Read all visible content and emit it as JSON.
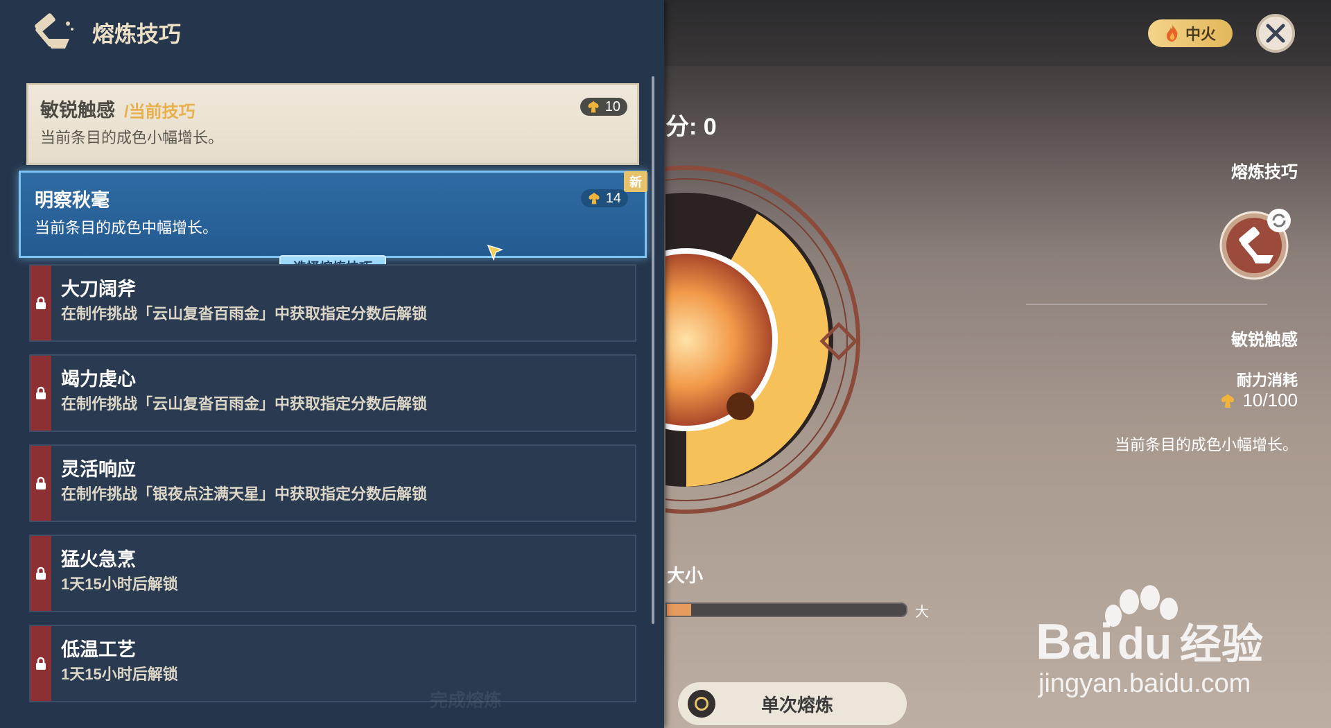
{
  "panel": {
    "title": "熔炼技巧",
    "current": {
      "title": "敏锐触感",
      "tag": "/当前技巧",
      "desc": "当前条目的成色小幅增长。",
      "cost": "10"
    },
    "selected": {
      "title": "明察秋毫",
      "desc": "当前条目的成色中幅增长。",
      "cost": "14",
      "new_tag": "新",
      "select_label": "选择熔炼技巧"
    },
    "locked": [
      {
        "title": "大刀阔斧",
        "desc": "在制作挑战「云山复沓百雨金」中获取指定分数后解锁"
      },
      {
        "title": "竭力虔心",
        "desc": "在制作挑战「云山复沓百雨金」中获取指定分数后解锁"
      },
      {
        "title": "灵活响应",
        "desc": "在制作挑战「银夜点注满天星」中获取指定分数后解锁"
      },
      {
        "title": "猛火急烹",
        "desc": "1天15小时后解锁"
      },
      {
        "title": "低温工艺",
        "desc": "1天15小时后解锁"
      }
    ],
    "bottom_ghost": "完成熔炼"
  },
  "scene": {
    "score": "分: 0",
    "size_label": "大小",
    "size_end": "大",
    "size_level": 0.1,
    "fire_label": "中火",
    "single_button": "单次熔炼"
  },
  "right_panel": {
    "title": "熔炼技巧",
    "name": "敏锐触感",
    "cost_label": "耐力消耗",
    "cost": "10/100",
    "desc": "当前条目的成色小幅增长。"
  },
  "watermark": {
    "brand": "Bai",
    "brand2": "du",
    "cn": "经验",
    "url": "jingyan.baidu.com"
  },
  "colors": {
    "accent_blue": "#7fc3f2",
    "lock_red": "#8c3033",
    "gold": "#e8b04a",
    "panel_bg": "#25354b"
  },
  "icons": [
    "hammer-bowl-icon",
    "stamina-icon",
    "lock-icon",
    "close-icon",
    "flame-icon",
    "refresh-icon",
    "cursor-icon"
  ]
}
